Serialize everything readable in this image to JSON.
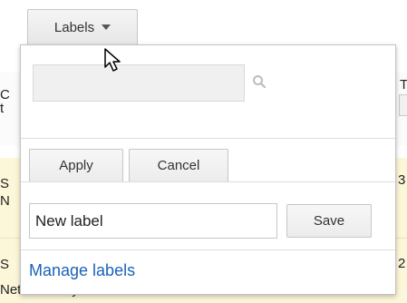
{
  "toolbar": {
    "labels_button": "Labels"
  },
  "background": {
    "frag_row_header_top": "C",
    "frag_row_header_bottom": "t",
    "frag_row_header_right": "T",
    "frag_row1_top": "S",
    "frag_row1_bottom": "N",
    "frag_row1_right": "3",
    "frag_row2_top": "S",
    "frag_row2_bottom": "Network only",
    "frag_row2_right": "2"
  },
  "dropdown": {
    "search_value": "",
    "apply_label": "Apply",
    "cancel_label": "Cancel",
    "new_label_value": "New label",
    "save_label": "Save",
    "manage_labels": "Manage labels"
  }
}
